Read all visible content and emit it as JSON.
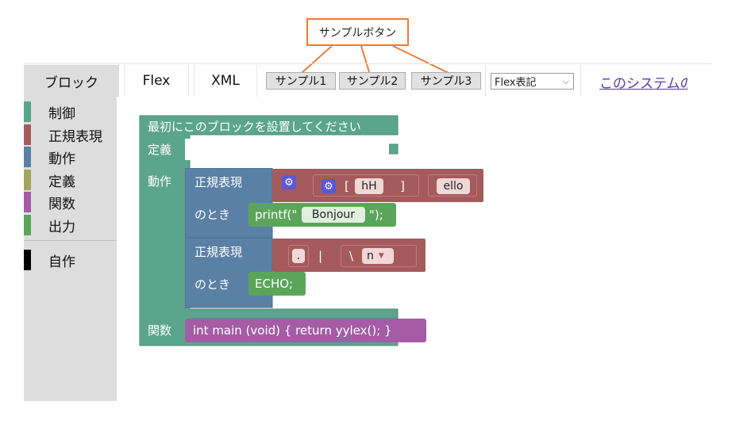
{
  "annotation": {
    "label": "サンプルボタン"
  },
  "tabs": [
    {
      "label": "ブロック"
    },
    {
      "label": "Flex"
    },
    {
      "label": "XML"
    }
  ],
  "sample_buttons": [
    {
      "label": "サンプル1"
    },
    {
      "label": "サンプル2"
    },
    {
      "label": "サンプル3"
    }
  ],
  "format_select": {
    "value": "Flex表記"
  },
  "system_link": {
    "label": "このシステムの使"
  },
  "categories": [
    {
      "label": "制御",
      "color": "#5ba58c"
    },
    {
      "label": "正規表現",
      "color": "#a55b5b"
    },
    {
      "label": "動作",
      "color": "#5b80a5"
    },
    {
      "label": "定義",
      "color": "#a5a55b"
    },
    {
      "label": "関数",
      "color": "#a55ba5"
    },
    {
      "label": "出力",
      "color": "#5ba55b"
    },
    {
      "label": "自作",
      "color": "#000000"
    }
  ],
  "workspace": {
    "main_block": {
      "title": "最初にこのブロックを設置してください",
      "def_label": "定義",
      "action_label": "動作",
      "func_label": "関数",
      "color": "#5ba58c"
    },
    "rule1": {
      "regex_label": "正規表現",
      "when_label": "のとき",
      "bracket_open": "[",
      "bracket_value": "hH",
      "bracket_close": "]",
      "literal": "ello",
      "printf_prefix": "printf(\"",
      "printf_value": "Bonjour",
      "printf_suffix": "\");"
    },
    "rule2": {
      "regex_label": "正規表現",
      "when_label": "のとき",
      "dot": ".",
      "pipe": "|",
      "backslash": "\\",
      "escape_value": "n",
      "echo": "ECHO;"
    },
    "function_code": "int main (void) { return yylex(); }",
    "colors": {
      "regex": "#a55b5b",
      "action": "#5b80a5",
      "output": "#5ba55b",
      "function": "#a55ba5"
    }
  }
}
